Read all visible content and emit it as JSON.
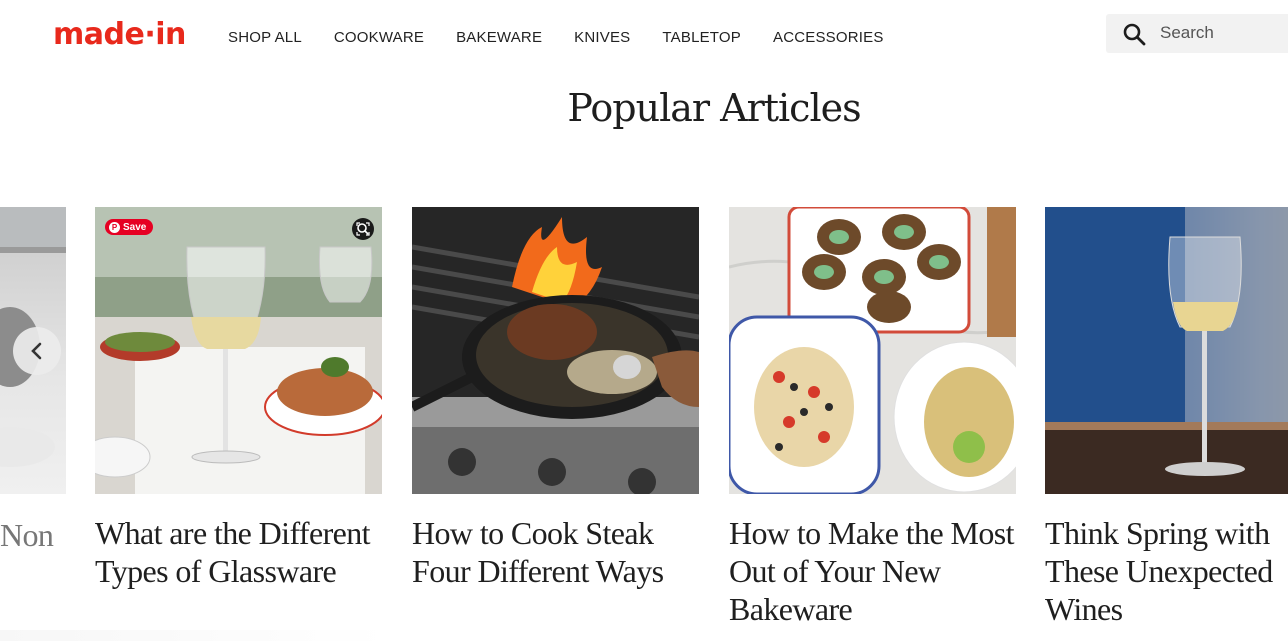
{
  "header": {
    "logo": "made·in",
    "nav": [
      "SHOP ALL",
      "COOKWARE",
      "BAKEWARE",
      "KNIVES",
      "TABLETOP",
      "ACCESSORIES"
    ],
    "search": {
      "placeholder": "Search",
      "icon": "search-icon"
    }
  },
  "section": {
    "title": "Popular Articles"
  },
  "carousel": {
    "prev_icon": "chevron-left-icon",
    "partial_title": "Non",
    "save_label": "Save",
    "cards": [
      {
        "title": "What are the Different Types of Glassware"
      },
      {
        "title": "How to Cook Steak Four Different Ways"
      },
      {
        "title": "How to Make the Most Out of Your New Bakeware"
      },
      {
        "title": "Think Spring with These Unexpected Wines"
      }
    ]
  },
  "colors": {
    "brand": "#e8291c",
    "pinterest": "#e60023",
    "text": "#1f1f1f"
  }
}
